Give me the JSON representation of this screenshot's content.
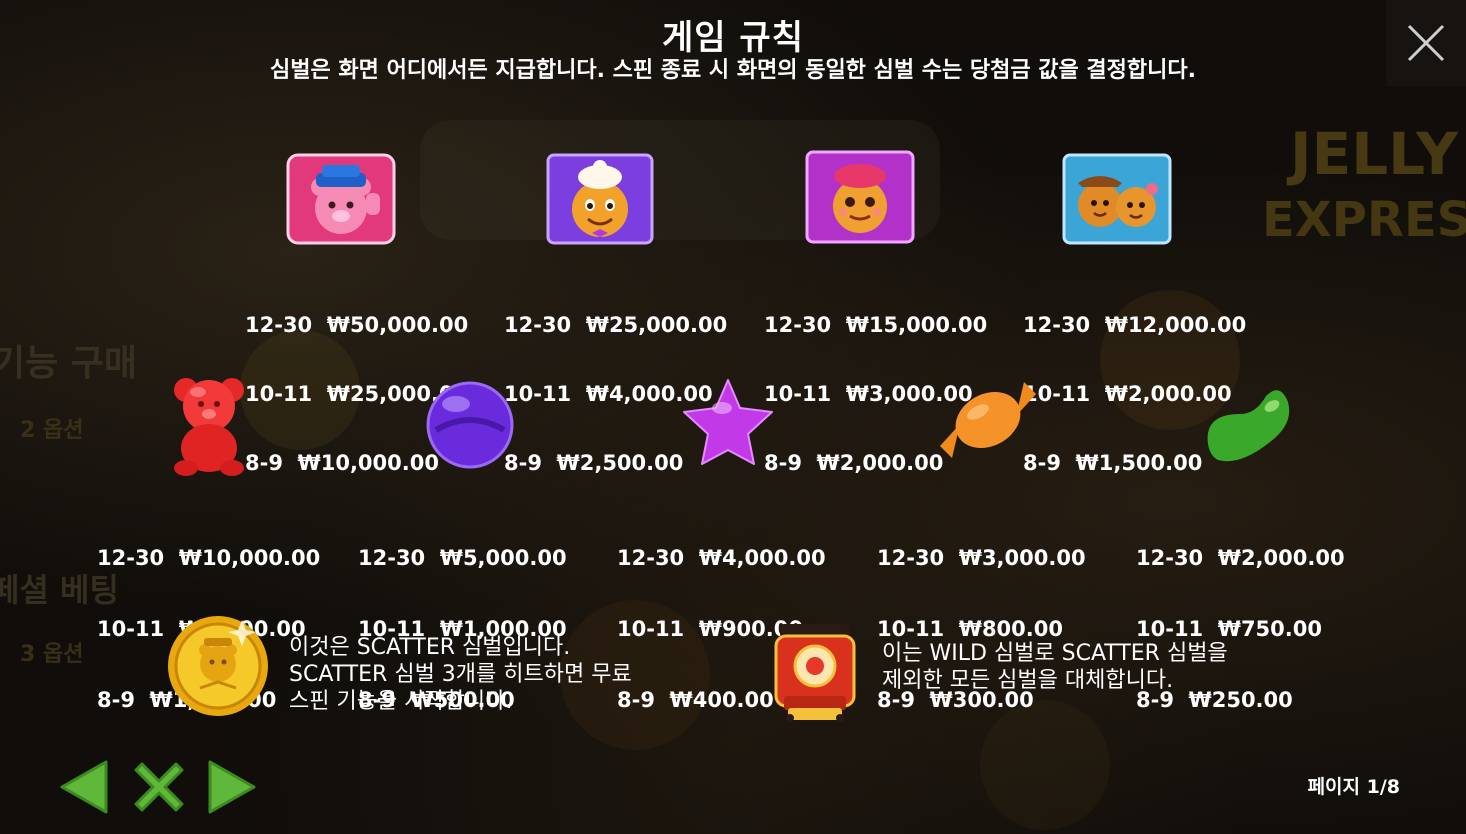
{
  "header": {
    "title": "게임 규칙",
    "subtitle": "심벌은 화면 어디에서든 지급합니다. 스핀 종료 시 화면의 동일한 심벌 수는 당첨금 값을 결정합니다."
  },
  "background": {
    "left_text_1": "기능 구매",
    "left_text_2": "2 옵션",
    "left_text_3": "페셜 베팅",
    "left_text_4": "3 옵션",
    "logo_text_1": "JELLY",
    "logo_text_2": "EXPRESS"
  },
  "paytable_row1": [
    {
      "icon": "bear-conductor-icon",
      "lines": [
        "12-30  ₩50,000.00",
        "10-11  ₩25,000.00",
        "8-9  ₩10,000.00"
      ]
    },
    {
      "icon": "gingerbread-chef-icon",
      "lines": [
        "12-30  ₩25,000.00",
        "10-11  ₩4,000.00",
        "8-9  ₩2,500.00"
      ]
    },
    {
      "icon": "gingerbread-girl-icon",
      "lines": [
        "12-30  ₩15,000.00",
        "10-11  ₩3,000.00",
        "8-9  ₩2,000.00"
      ]
    },
    {
      "icon": "gingerbread-couple-icon",
      "lines": [
        "12-30  ₩12,000.00",
        "10-11  ₩2,000.00",
        "8-9  ₩1,500.00"
      ]
    }
  ],
  "paytable_row2": [
    {
      "icon": "red-gummy-bear-icon",
      "lines": [
        "12-30  ₩10,000.00",
        "10-11  ₩1,500.00",
        "8-9  ₩1,000.00"
      ]
    },
    {
      "icon": "purple-lollipop-icon",
      "lines": [
        "12-30  ₩5,000.00",
        "10-11  ₩1,000.00",
        "8-9  ₩500.00"
      ]
    },
    {
      "icon": "purple-star-candy-icon",
      "lines": [
        "12-30  ₩4,000.00",
        "10-11  ₩900.00",
        "8-9  ₩400.00"
      ]
    },
    {
      "icon": "orange-wrapped-candy-icon",
      "lines": [
        "12-30  ₩3,000.00",
        "10-11  ₩800.00",
        "8-9  ₩300.00"
      ]
    },
    {
      "icon": "green-jellybean-icon",
      "lines": [
        "12-30  ₩2,000.00",
        "10-11  ₩750.00",
        "8-9  ₩250.00"
      ]
    }
  ],
  "scatter": {
    "icon": "gold-coin-scatter-icon",
    "lines": [
      "이것은 SCATTER 심벌입니다.",
      "SCATTER 심벌 3개를 히트하면 무료",
      "스핀 기능을 시작합니다."
    ]
  },
  "wild": {
    "icon": "train-wild-icon",
    "lines": [
      "이는 WILD 심벌로 SCATTER 심벌을",
      "제외한 모든 심벌을 대체합니다."
    ]
  },
  "nav": {
    "prev_icon": "arrow-left-icon",
    "close_icon": "x-icon",
    "next_icon": "arrow-right-icon",
    "page_label": "페이지 1/8"
  },
  "colors": {
    "nav_green": "#5fb83a",
    "background": "#100d0a",
    "text": "#ffffff"
  }
}
